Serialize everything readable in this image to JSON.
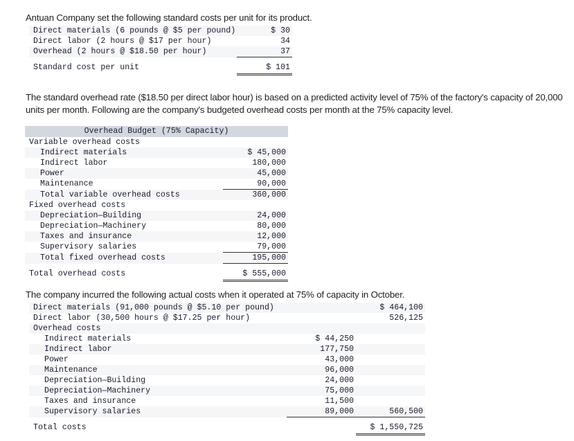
{
  "document": {
    "intro_paragraph": "Antuan Company set the following standard costs per unit for its product.",
    "overhead_rate_paragraph": "The standard overhead rate ($18.50 per direct labor hour) is based on a predicted activity level of 75% of the factory's capacity of 20,000 units per month. Following are the company's budgeted overhead costs per month at the 75% capacity level.",
    "actual_costs_paragraph": "The company incurred the following actual costs when it operated at 75% of capacity in October."
  },
  "standard_cost_table": {
    "rows": [
      {
        "label": "Direct materials (6 pounds @ $5 per pound)",
        "amount": "$ 30"
      },
      {
        "label": "Direct labor (2 hours @ $17 per hour)",
        "amount": "34"
      },
      {
        "label": "Overhead (2 hours @ $18.50 per hour)",
        "amount": "37"
      },
      {
        "label": "Standard cost per unit",
        "amount": "$ 101"
      }
    ]
  },
  "overhead_budget_table": {
    "header": "Overhead Budget (75% Capacity)",
    "rows": [
      {
        "label": "Variable overhead costs",
        "amount": ""
      },
      {
        "label": "Indirect materials",
        "amount": "$ 45,000"
      },
      {
        "label": "Indirect labor",
        "amount": "180,000"
      },
      {
        "label": "Power",
        "amount": "45,000"
      },
      {
        "label": "Maintenance",
        "amount": "90,000"
      },
      {
        "label": "Total variable overhead costs",
        "amount": "360,000"
      },
      {
        "label": "Fixed overhead costs",
        "amount": ""
      },
      {
        "label": "Depreciation—Building",
        "amount": "24,000"
      },
      {
        "label": "Depreciation—Machinery",
        "amount": "80,000"
      },
      {
        "label": "Taxes and insurance",
        "amount": "12,000"
      },
      {
        "label": "Supervisory salaries",
        "amount": "79,000"
      },
      {
        "label": "Total fixed overhead costs",
        "amount": "195,000"
      },
      {
        "label": "Total overhead costs",
        "amount": "$ 555,000"
      }
    ]
  },
  "actual_costs_table": {
    "rows": [
      {
        "label": "Direct materials (91,000 pounds @ $5.10 per pound)",
        "col1": "",
        "col2": "$ 464,100"
      },
      {
        "label": "Direct labor (30,500 hours @ $17.25 per hour)",
        "col1": "",
        "col2": "526,125"
      },
      {
        "label": "Overhead costs",
        "col1": "",
        "col2": ""
      },
      {
        "label": "Indirect materials",
        "col1": "$ 44,250",
        "col2": ""
      },
      {
        "label": "Indirect labor",
        "col1": "177,750",
        "col2": ""
      },
      {
        "label": "Power",
        "col1": "43,000",
        "col2": ""
      },
      {
        "label": "Maintenance",
        "col1": "96,000",
        "col2": ""
      },
      {
        "label": "Depreciation—Building",
        "col1": "24,000",
        "col2": ""
      },
      {
        "label": "Depreciation—Machinery",
        "col1": "75,000",
        "col2": ""
      },
      {
        "label": "Taxes and insurance",
        "col1": "11,500",
        "col2": ""
      },
      {
        "label": "Supervisory salaries",
        "col1": "89,000",
        "col2": "560,500"
      },
      {
        "label": "Total costs",
        "col1": "",
        "col2": "$ 1,550,725"
      }
    ]
  },
  "colors": {
    "table_header_bg": "#d3d8e0",
    "stripe_bg": "#f5f6f7",
    "text": "#1a1a2e",
    "rule": "#333333"
  }
}
